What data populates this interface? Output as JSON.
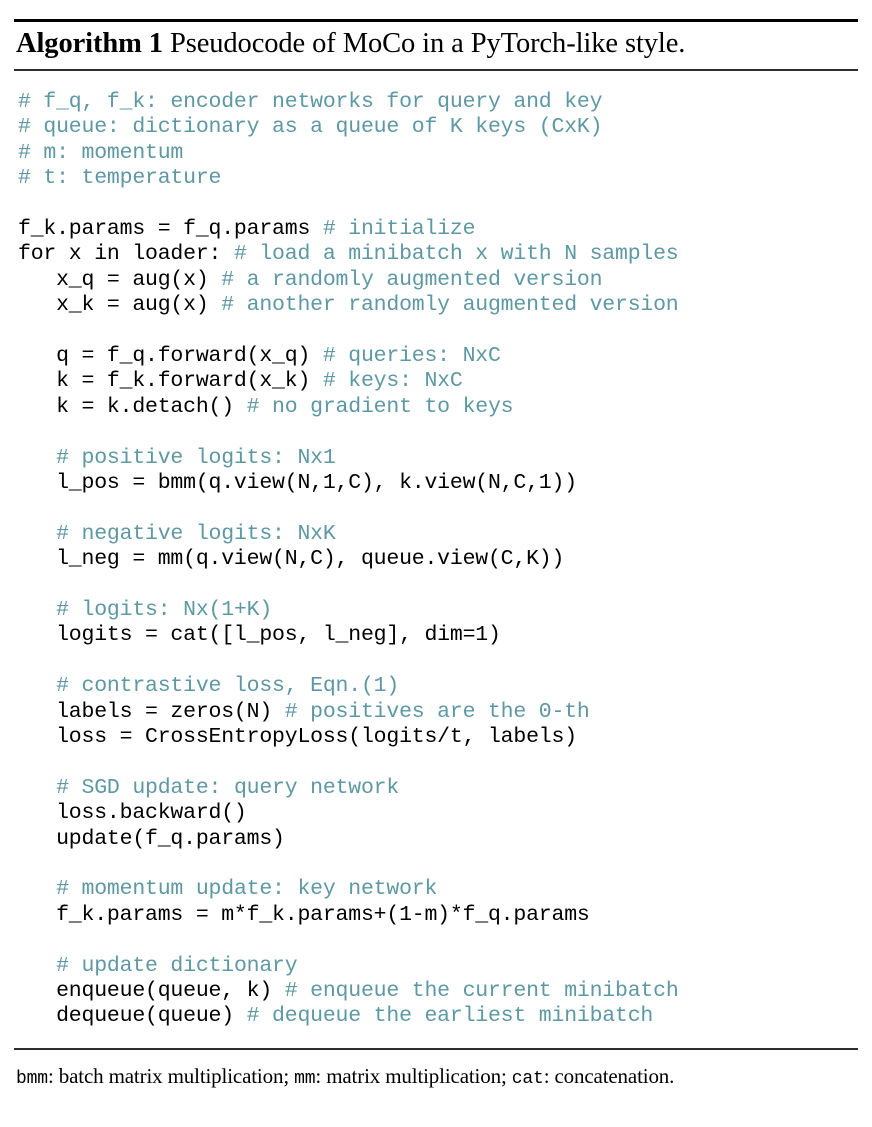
{
  "algorithm": {
    "label": "Algorithm 1",
    "caption": "Pseudocode of MoCo in a PyTorch-like style.",
    "colors": {
      "code": "#000000",
      "comment": "#5d98a3",
      "rule": "#000000"
    },
    "code_lines": [
      {
        "indent": 0,
        "code": "",
        "comment": "# f_q, f_k: encoder networks for query and key"
      },
      {
        "indent": 0,
        "code": "",
        "comment": "# queue: dictionary as a queue of K keys (CxK)"
      },
      {
        "indent": 0,
        "code": "",
        "comment": "# m: momentum"
      },
      {
        "indent": 0,
        "code": "",
        "comment": "# t: temperature"
      },
      {
        "indent": 0,
        "code": "",
        "comment": ""
      },
      {
        "indent": 0,
        "code": "f_k.params = f_q.params ",
        "comment": "# initialize"
      },
      {
        "indent": 0,
        "code": "for x in loader: ",
        "comment": "# load a minibatch x with N samples"
      },
      {
        "indent": 3,
        "code": "x_q = aug(x) ",
        "comment": "# a randomly augmented version"
      },
      {
        "indent": 3,
        "code": "x_k = aug(x) ",
        "comment": "# another randomly augmented version"
      },
      {
        "indent": 0,
        "code": "",
        "comment": ""
      },
      {
        "indent": 3,
        "code": "q = f_q.forward(x_q) ",
        "comment": "# queries: NxC"
      },
      {
        "indent": 3,
        "code": "k = f_k.forward(x_k) ",
        "comment": "# keys: NxC"
      },
      {
        "indent": 3,
        "code": "k = k.detach() ",
        "comment": "# no gradient to keys"
      },
      {
        "indent": 0,
        "code": "",
        "comment": ""
      },
      {
        "indent": 3,
        "code": "",
        "comment": "# positive logits: Nx1"
      },
      {
        "indent": 3,
        "code": "l_pos = bmm(q.view(N,1,C), k.view(N,C,1))",
        "comment": ""
      },
      {
        "indent": 0,
        "code": "",
        "comment": ""
      },
      {
        "indent": 3,
        "code": "",
        "comment": "# negative logits: NxK"
      },
      {
        "indent": 3,
        "code": "l_neg = mm(q.view(N,C), queue.view(C,K))",
        "comment": ""
      },
      {
        "indent": 0,
        "code": "",
        "comment": ""
      },
      {
        "indent": 3,
        "code": "",
        "comment": "# logits: Nx(1+K)"
      },
      {
        "indent": 3,
        "code": "logits = cat([l_pos, l_neg], dim=1)",
        "comment": ""
      },
      {
        "indent": 0,
        "code": "",
        "comment": ""
      },
      {
        "indent": 3,
        "code": "",
        "comment": "# contrastive loss, Eqn.(1)"
      },
      {
        "indent": 3,
        "code": "labels = zeros(N) ",
        "comment": "# positives are the 0-th"
      },
      {
        "indent": 3,
        "code": "loss = CrossEntropyLoss(logits/t, labels)",
        "comment": ""
      },
      {
        "indent": 0,
        "code": "",
        "comment": ""
      },
      {
        "indent": 3,
        "code": "",
        "comment": "# SGD update: query network"
      },
      {
        "indent": 3,
        "code": "loss.backward()",
        "comment": ""
      },
      {
        "indent": 3,
        "code": "update(f_q.params)",
        "comment": ""
      },
      {
        "indent": 0,
        "code": "",
        "comment": ""
      },
      {
        "indent": 3,
        "code": "",
        "comment": "# momentum update: key network"
      },
      {
        "indent": 3,
        "code": "f_k.params = m*f_k.params+(1-m)*f_q.params",
        "comment": ""
      },
      {
        "indent": 0,
        "code": "",
        "comment": ""
      },
      {
        "indent": 3,
        "code": "",
        "comment": "# update dictionary"
      },
      {
        "indent": 3,
        "code": "enqueue(queue, k) ",
        "comment": "# enqueue the current minibatch"
      },
      {
        "indent": 3,
        "code": "dequeue(queue) ",
        "comment": "# dequeue the earliest minibatch"
      }
    ],
    "footer": {
      "term1": "bmm",
      "desc1": ": batch matrix multiplication; ",
      "term2": "mm",
      "desc2": ": matrix multiplication; ",
      "term3": "cat",
      "desc3": ": concatenation."
    }
  }
}
